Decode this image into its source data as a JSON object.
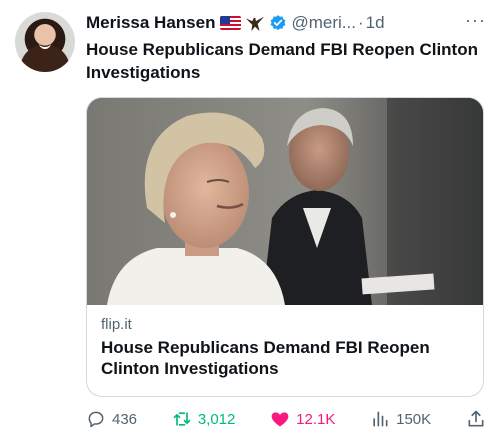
{
  "tweet": {
    "author_name": "Merissa Hansen",
    "handle": "@meri...",
    "separator": "·",
    "time": "1d",
    "more": "···",
    "text": "House Republicans Demand FBI Reopen Clinton Investigations"
  },
  "card": {
    "domain": "flip.it",
    "title": "House Republicans Demand FBI Reopen Clinton Investigations"
  },
  "actions": {
    "replies": "436",
    "reposts": "3,012",
    "likes": "12.1K",
    "views": "150K"
  },
  "colors": {
    "verified": "#1d9bf0",
    "repost": "#00ba7c",
    "like": "#f91880",
    "muted": "#536471"
  },
  "icons": [
    "us-flag-icon",
    "eagle-icon",
    "verified-badge-icon",
    "reply-icon",
    "repost-icon",
    "like-icon",
    "views-icon",
    "share-icon"
  ]
}
